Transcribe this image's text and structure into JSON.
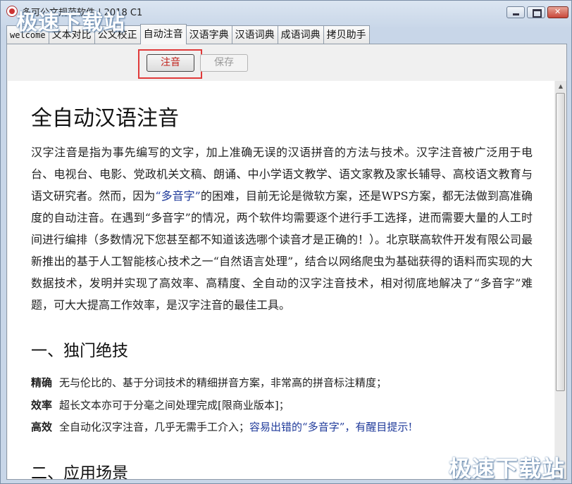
{
  "window": {
    "title": "多可公文规范软件 | 2018 C1"
  },
  "watermark": {
    "text": "极速下载站"
  },
  "tabs": [
    {
      "label": "welcome"
    },
    {
      "label": "文本对比"
    },
    {
      "label": "公文校正"
    },
    {
      "label": "自动注音",
      "active": true
    },
    {
      "label": "汉语字典"
    },
    {
      "label": "汉语词典"
    },
    {
      "label": "成语词典"
    },
    {
      "label": "拷贝助手"
    }
  ],
  "toolbar": {
    "annotate_label": "注音",
    "save_label": "保存"
  },
  "doc": {
    "title": "全自动汉语注音",
    "intro_1": "汉字注音是指为事先编写的文字，加上准确无误的汉语拼音的方法与技术。汉字注音被广泛用于电台、电视台、电影、党政机关文稿、朗诵、中小学语文教学、语文家教及家长辅导、高校语文教育与语文研究者。然而，因为",
    "intro_quote": "“多音字”",
    "intro_2": "的困难，目前无论是微软方案，还是WPS方案，都无法做到高准确度的自动注音。在遇到“多音字”的情况，两个软件均需要逐个进行手工选择，进而需要大量的人工时间进行编排（多数情况下您甚至都不知道该选哪个读音才是正确的！）。北京联高软件开发有限公司最新推出的基于人工智能核心技术之一“自然语言处理”，结合以网络爬虫为基础获得的语料而实现的大数据技术，发明并实现了高效率、高精度、全自动的汉字注音技术，相对彻底地解决了“多音字”难题，可大大提高工作效率，是汉字注音的最佳工具。",
    "section1_title": "一、独门绝技",
    "features": [
      {
        "term": "精确",
        "desc": "无与伦比的、基于分词技术的精细拼音方案，非常高的拼音标注精度；",
        "highlight": ""
      },
      {
        "term": "效率",
        "desc": "超长文本亦可于分毫之间处理完成[限商业版本]；",
        "highlight": ""
      },
      {
        "term": "高效",
        "desc": "全自动化汉字注音，几乎无需手工介入；",
        "highlight": "容易出错的“多音字”，有醒目提示!"
      }
    ],
    "section2_title": "二、应用场景"
  },
  "colors": {
    "accent_red": "#e03a3a",
    "link_blue": "#1f3a9a"
  },
  "icons": {
    "app": "app-logo-icon",
    "minimize": "minimize-icon",
    "maximize": "maximize-icon",
    "close": "close-icon"
  }
}
